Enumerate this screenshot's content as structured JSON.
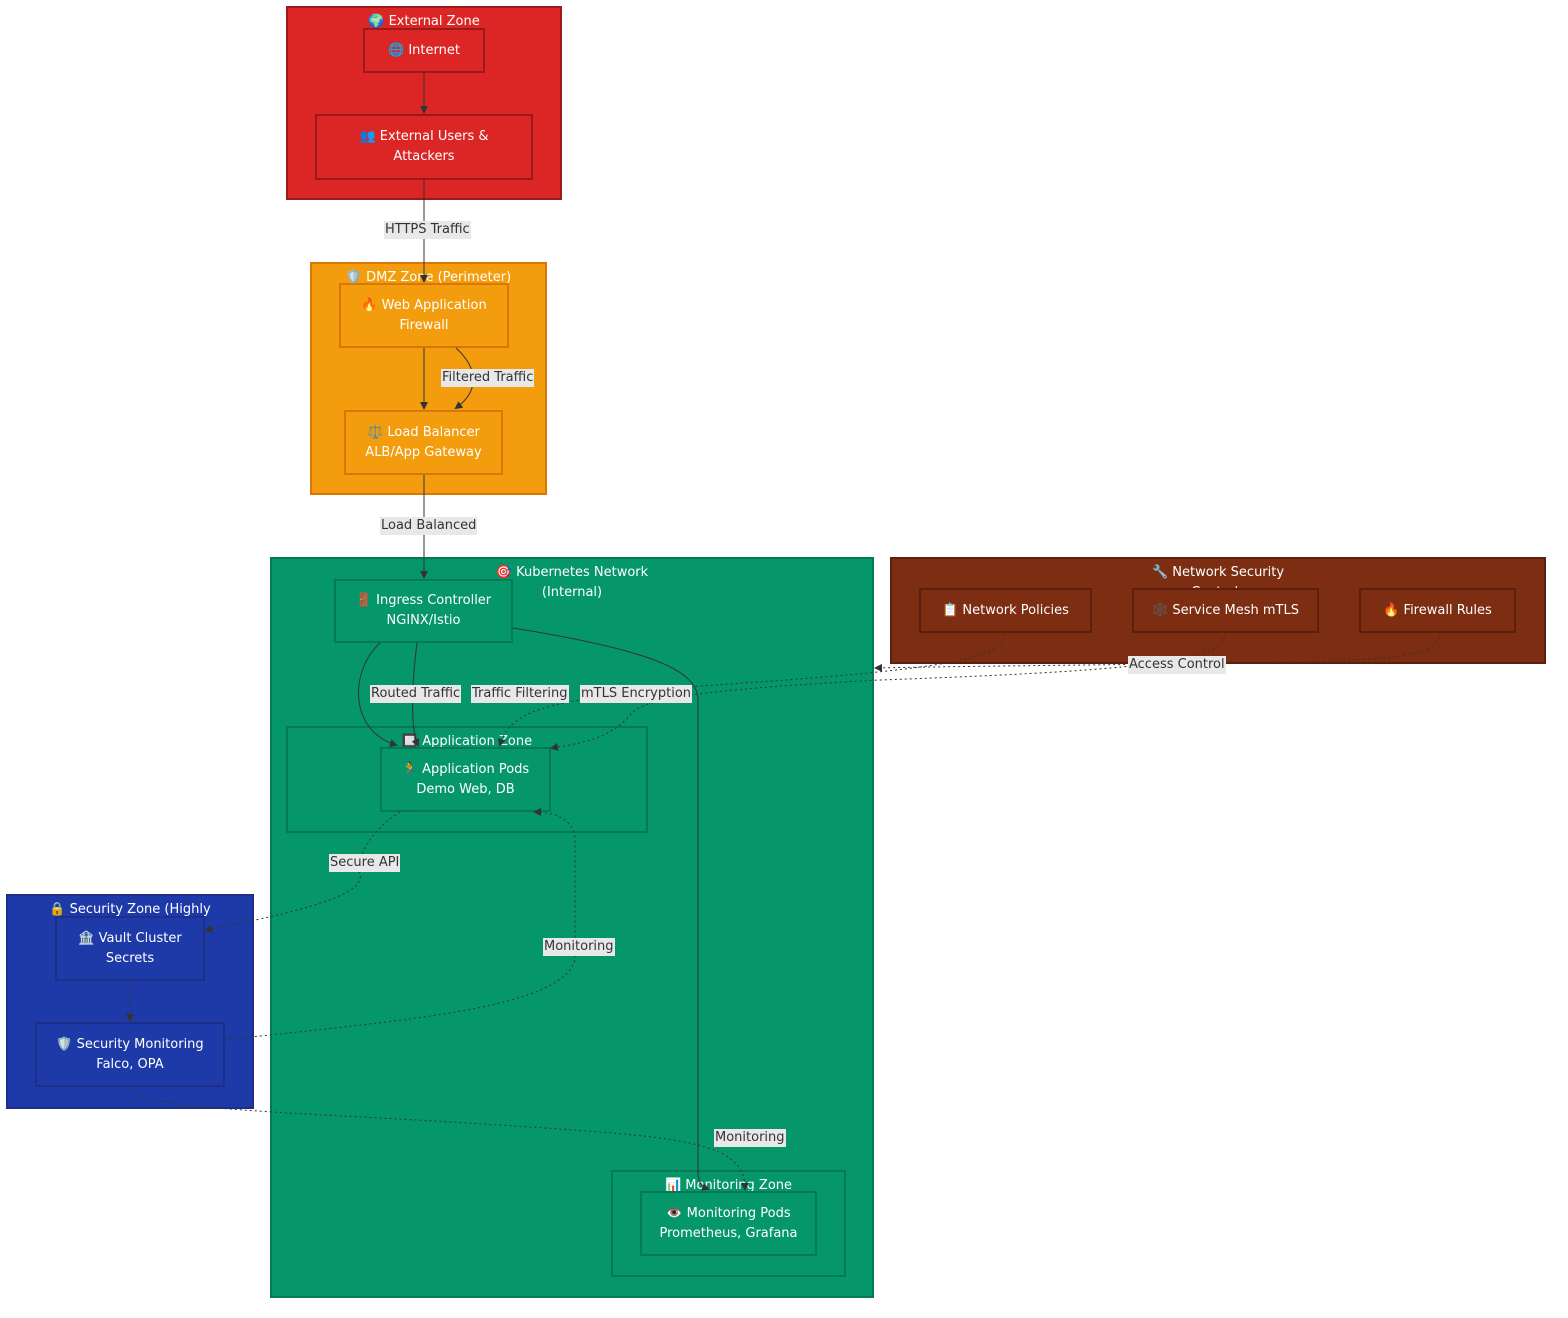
{
  "colors": {
    "external": "#dc2626",
    "external_border": "#991b1b",
    "dmz": "#f39c0d",
    "dmz_border": "#d97706",
    "k8s": "#059669",
    "k8s_border": "#047857",
    "controls": "#7c2d12",
    "controls_border": "#5a1f0d",
    "security": "#1e3aa8",
    "security_border": "#1e2f8a",
    "edge": "#333333"
  },
  "zones": {
    "external": "🌍 External Zone",
    "dmz": "🛡️ DMZ Zone (Perimeter)",
    "k8s": "🎯 Kubernetes Network\n(Internal)",
    "app": "🔲 Application Zone",
    "monitoring": "📊 Monitoring Zone",
    "controls": "🔧 Network Security\nControls",
    "security": "🔒 Security Zone (Highly"
  },
  "nodes": {
    "internet": "🌐 Internet",
    "external_users": "👥 External Users &\nAttackers",
    "waf": "🔥 Web Application\nFirewall",
    "load_balancer": "⚖️ Load Balancer\nALB/App Gateway",
    "ingress": "🚪 Ingress Controller\nNGINX/Istio",
    "app_pods": "🏃 Application Pods\nDemo Web, DB",
    "monitoring_pods": "👁️ Monitoring Pods\nPrometheus, Grafana",
    "network_policies": "📋 Network Policies",
    "service_mesh": "🕸️ Service Mesh mTLS",
    "firewall_rules": "🔥 Firewall Rules",
    "vault": "🏦 Vault Cluster\nSecrets",
    "security_monitoring": "🛡️ Security Monitoring\nFalco, OPA"
  },
  "edge_labels": {
    "https": "HTTPS Traffic",
    "filtered": "Filtered Traffic",
    "load_balanced": "Load Balanced",
    "routed": "Routed Traffic",
    "traffic_filtering": "Traffic Filtering",
    "mtls": "mTLS Encryption",
    "access_control": "Access Control",
    "secure_api": "Secure API",
    "monitoring_1": "Monitoring",
    "monitoring_2": "Monitoring"
  }
}
